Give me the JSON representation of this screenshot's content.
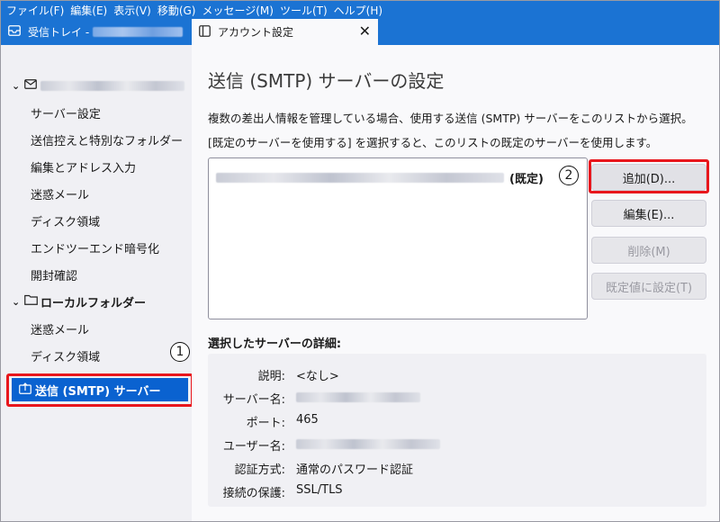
{
  "menubar": {
    "items": [
      "ファイル(F)",
      "編集(E)",
      "表示(V)",
      "移動(G)",
      "メッセージ(M)",
      "ツール(T)",
      "ヘルプ(H)"
    ]
  },
  "tabs": {
    "inbox_label": "受信トレイ -",
    "account_label": "アカウント設定",
    "close_glyph": "✕"
  },
  "sidebar": {
    "account_children": [
      "サーバー設定",
      "送信控えと特別なフォルダー",
      "編集とアドレス入力",
      "迷惑メール",
      "ディスク領域",
      "エンドツーエンド暗号化",
      "開封確認"
    ],
    "local_folder_label": "ローカルフォルダー",
    "local_children": [
      "迷惑メール",
      "ディスク領域"
    ],
    "smtp_label": "送信 (SMTP) サーバー"
  },
  "callouts": {
    "one": "1",
    "two": "2"
  },
  "main": {
    "title": "送信 (SMTP) サーバーの設定",
    "desc1": "複数の差出人情報を管理している場合、使用する送信 (SMTP) サーバーをこのリストから選択。",
    "desc2": "[既定のサーバーを使用する] を選択すると、このリストの既定のサーバーを使用します。",
    "default_tag": "(既定)",
    "buttons": {
      "add": "追加(D)...",
      "edit": "編集(E)...",
      "delete": "削除(M)",
      "set_default": "既定値に設定(T)"
    },
    "details_heading": "選択したサーバーの詳細:",
    "details": {
      "description_label": "説明:",
      "description_value": "<なし>",
      "server_label": "サーバー名:",
      "port_label": "ポート:",
      "port_value": "465",
      "user_label": "ユーザー名:",
      "auth_label": "認証方式:",
      "auth_value": "通常のパスワード認証",
      "security_label": "接続の保護:",
      "security_value": "SSL/TLS"
    }
  },
  "colors": {
    "accent": "#1b73d3",
    "selected": "#0a62d0",
    "highlight": "#e8161c"
  }
}
